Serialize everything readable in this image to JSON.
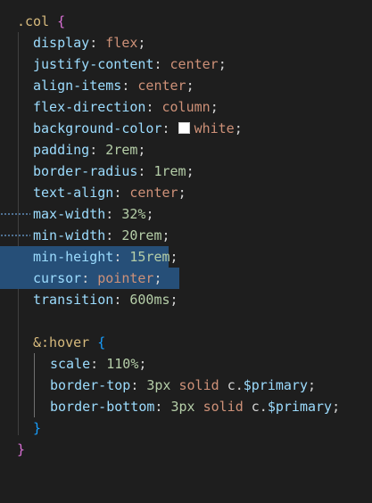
{
  "editor": {
    "colors": {
      "background": "#1e1e1e",
      "selection": "#264f78",
      "property": "#9cdcfe",
      "string_value": "#ce9178",
      "number": "#b5cea8",
      "selector": "#d7ba7d",
      "brace_outer": "#da70d6",
      "brace_inner": "#179fff"
    },
    "selector": ".col",
    "open_brace": "{",
    "close_brace": "}",
    "declarations": [
      {
        "prop": "display",
        "value": "flex"
      },
      {
        "prop": "justify-content",
        "value": "center"
      },
      {
        "prop": "align-items",
        "value": "center"
      },
      {
        "prop": "flex-direction",
        "value": "column"
      },
      {
        "prop": "background-color",
        "value": "white",
        "swatch_color": "#ffffff"
      },
      {
        "prop": "padding",
        "num": "2",
        "unit": "rem"
      },
      {
        "prop": "border-radius",
        "num": "1",
        "unit": "rem"
      },
      {
        "prop": "text-align",
        "value": "center"
      },
      {
        "prop": "max-width",
        "num": "32",
        "unit": "%",
        "selected": true
      },
      {
        "prop": "min-width",
        "num": "20",
        "unit": "rem",
        "selected": true
      },
      {
        "prop": "min-height",
        "num": "15",
        "unit": "rem"
      },
      {
        "prop": "cursor",
        "value": "pointer"
      },
      {
        "prop": "transition",
        "num": "600",
        "unit": "ms"
      }
    ],
    "nested": {
      "amp": "&",
      "pseudo": ":hover",
      "open_brace": "{",
      "close_brace": "}",
      "declarations": [
        {
          "prop": "scale",
          "num": "110",
          "unit": "%"
        },
        {
          "prop": "border-top",
          "num": "3",
          "unit": "px",
          "keyword": "solid",
          "var_prefix": "c.",
          "var_name": "$primary"
        },
        {
          "prop": "border-bottom",
          "num": "3",
          "unit": "px",
          "keyword": "solid",
          "var_prefix": "c.",
          "var_name": "$primary"
        }
      ]
    }
  }
}
